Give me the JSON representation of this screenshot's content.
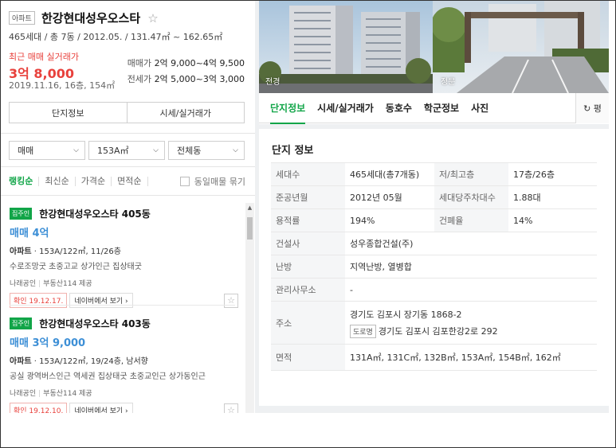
{
  "complex": {
    "type_badge": "아파트",
    "name": "한강현대성우오스타",
    "star": "☆",
    "summary": "465세대 / 총 7동 / 2012.05. / 131.47㎡ ~ 162.65㎡",
    "recent_label": "최근 매매 실거래가",
    "recent_price": "3억 8,000",
    "recent_date": "2019.11.16, 16층, 154㎡",
    "sale_label": "매매가",
    "sale_range": "2억 9,000~4억 9,500",
    "jeonse_label": "전세가",
    "jeonse_range": "2억 5,000~3억 3,000"
  },
  "left_tabs": [
    "단지정보",
    "시세/실거래가"
  ],
  "filters": {
    "trade": "매매",
    "area": "153A㎡",
    "dong": "전체동"
  },
  "sort": {
    "options": [
      "랭킹순",
      "최신순",
      "가격순",
      "면적순"
    ],
    "same_listing": "동일매물 묶기"
  },
  "listings": [
    {
      "owner_badge": "집주인",
      "title": "한강현대성우오스타 405동",
      "deal": "매매 4억",
      "spec_bold": "아파트",
      "spec": " · 153A/122㎡, 11/26층",
      "desc": "수로조망굿 초중고교 상가인근 집상태굿",
      "agent": "나래공인",
      "provider": "부동산114 제공",
      "verified": "확인 19.12.17.",
      "naver_link": "네이버에서 보기 ›",
      "fav": "☆"
    },
    {
      "owner_badge": "집주인",
      "title": "한강현대성우오스타 403동",
      "deal": "매매 3억 9,000",
      "spec_bold": "아파트",
      "spec": " · 153A/122㎡, 19/24층, 남서향",
      "desc": "공실 광역버스인근 역세권 집상태굿 초중교인근 상가동인근",
      "agent": "나래공인",
      "provider": "부동산114 제공",
      "verified": "확인 19.12.10.",
      "naver_link": "네이버에서 보기 ›",
      "fav": "☆"
    }
  ],
  "photos": {
    "front": "전경",
    "gate": "정문"
  },
  "right_tabs": [
    "단지정보",
    "시세/실거래가",
    "동호수",
    "학군정보",
    "사진"
  ],
  "refresh_label": "↻ 평",
  "info": {
    "title": "단지 정보",
    "rows": {
      "households_k": "세대수",
      "households_v": "465세대(총7개동)",
      "floors_k": "저/최고층",
      "floors_v": "17층/26층",
      "built_k": "준공년월",
      "built_v": "2012년 05월",
      "parking_k": "세대당주차대수",
      "parking_v": "1.88대",
      "far_k": "용적률",
      "far_v": "194%",
      "bcr_k": "건폐율",
      "bcr_v": "14%",
      "builder_k": "건설사",
      "builder_v": "성우종합건설(주)",
      "heating_k": "난방",
      "heating_v": "지역난방, 열병합",
      "office_k": "관리사무소",
      "office_v": "-",
      "address_k": "주소",
      "address_v": "경기도 김포시 장기동 1868-2",
      "road_badge": "도로명",
      "road_v": "경기도 김포시 김포한강2로 292",
      "area_k": "면적",
      "area_v": "131A㎡, 131C㎡, 132B㎡, 153A㎡, 154B㎡, 162㎡"
    }
  }
}
